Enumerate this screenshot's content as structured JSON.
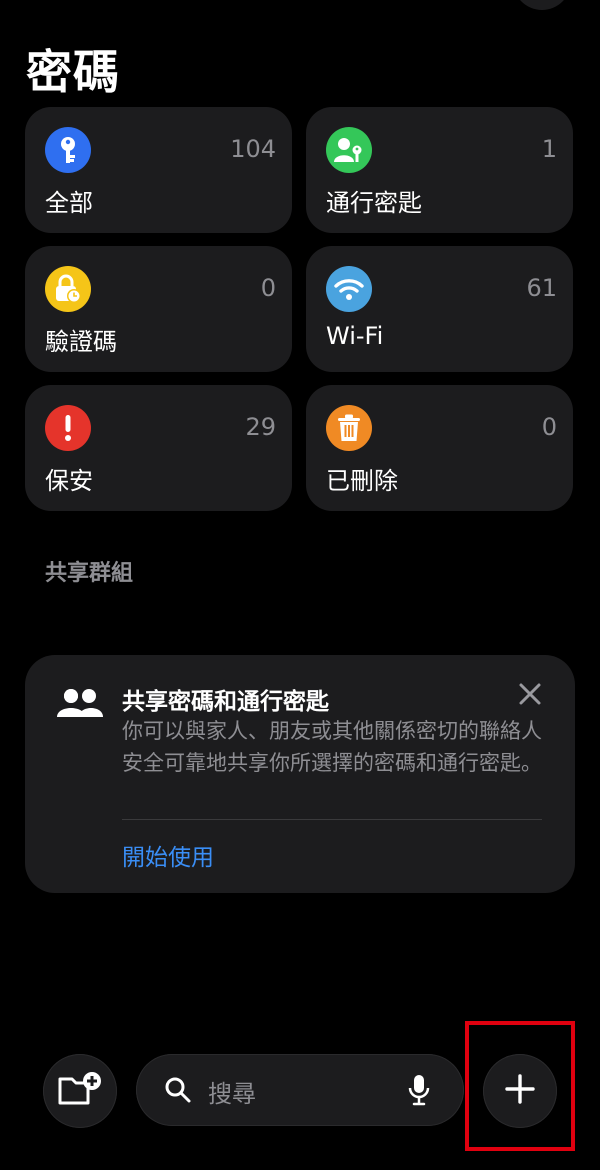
{
  "title": "密碼",
  "categories": [
    {
      "label": "全部",
      "count": "104",
      "icon": "key-icon",
      "color": "#2f6ff0"
    },
    {
      "label": "通行密匙",
      "count": "1",
      "icon": "person-key-icon",
      "color": "#34c759"
    },
    {
      "label": "驗證碼",
      "count": "0",
      "icon": "lock-clock-icon",
      "color": "#f5c518"
    },
    {
      "label": "Wi-Fi",
      "count": "61",
      "icon": "wifi-icon",
      "color": "#4aa3df"
    },
    {
      "label": "保安",
      "count": "29",
      "icon": "exclamation-icon",
      "color": "#e5342b"
    },
    {
      "label": "已刪除",
      "count": "0",
      "icon": "trash-icon",
      "color": "#f08a24"
    }
  ],
  "shared_groups_label": "共享群組",
  "share_card": {
    "title": "共享密碼和通行密匙",
    "body": "你可以與家人、朋友或其他關係密切的聯絡人安全可靠地共享你所選擇的密碼和通行密匙。",
    "cta": "開始使用"
  },
  "bottom_bar": {
    "search_placeholder": "搜尋",
    "new_folder_icon": "folder-plus-icon",
    "mic_icon": "microphone-icon",
    "add_icon": "plus-icon"
  },
  "colors": {
    "accent": "#3a8ef6",
    "highlight": "#e0000f"
  }
}
